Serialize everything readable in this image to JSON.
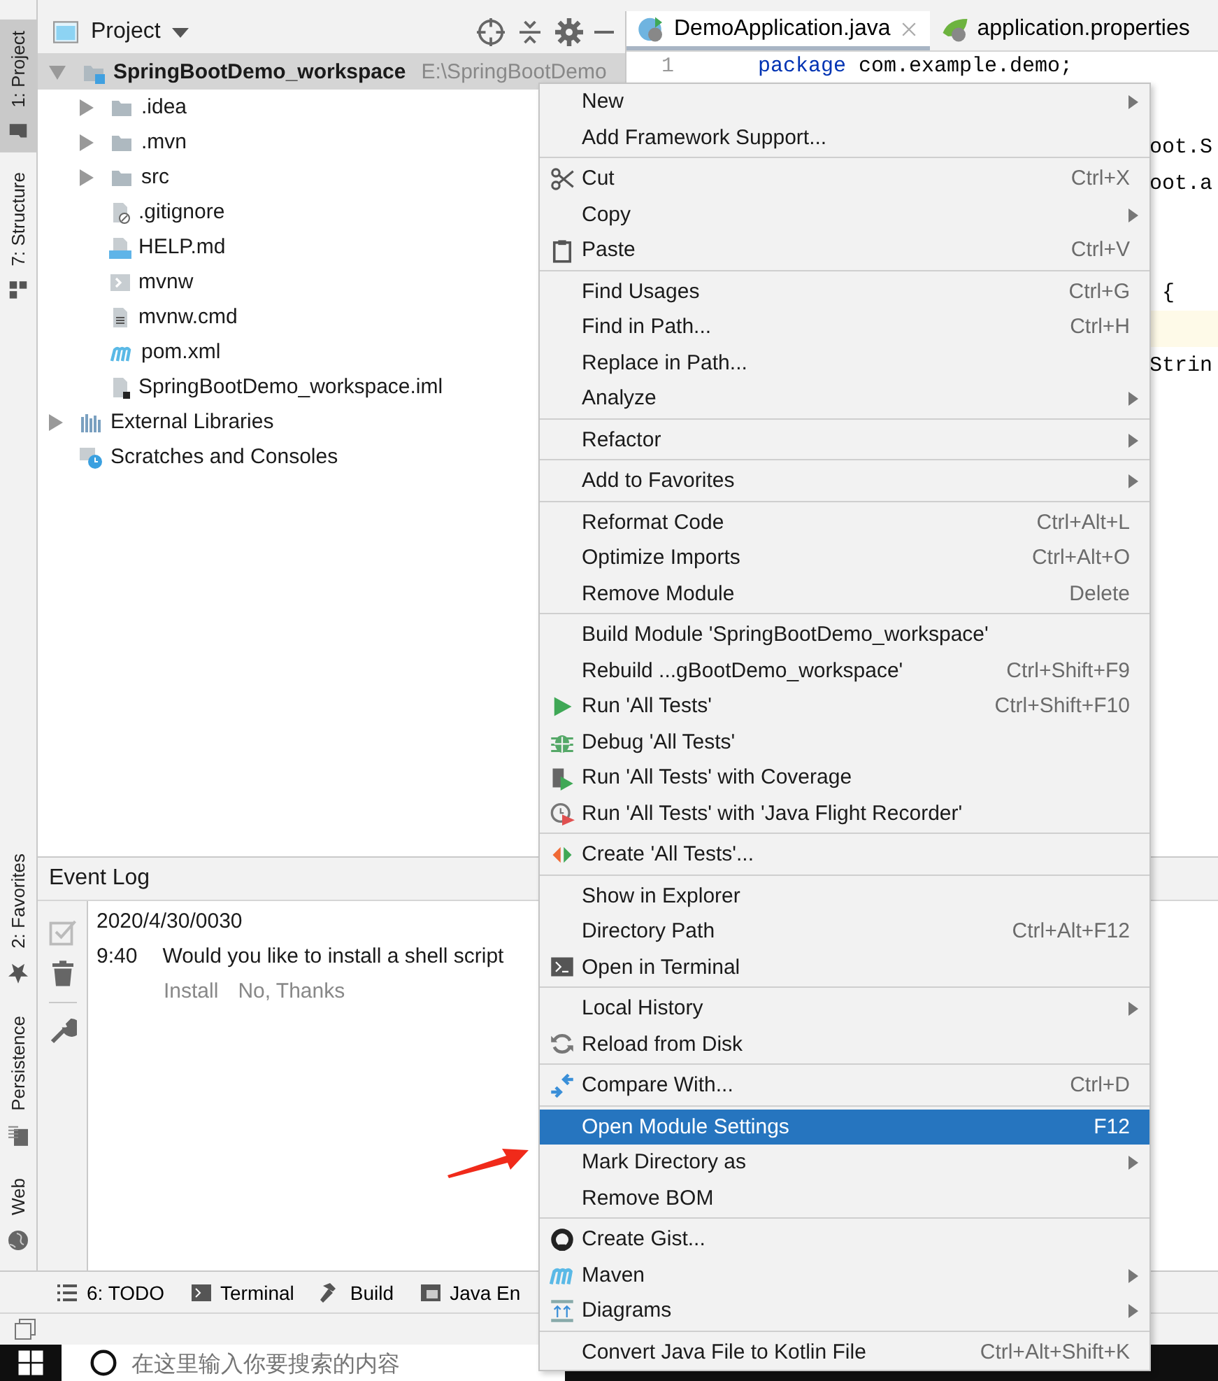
{
  "side_tabs_top": [
    {
      "label": "1: Project",
      "selected": true
    },
    {
      "label": "7: Structure",
      "selected": false
    }
  ],
  "side_tabs_bottom": [
    {
      "label": "2: Favorites",
      "selected": false
    },
    {
      "label": "Persistence",
      "selected": false
    },
    {
      "label": "Web",
      "selected": false
    }
  ],
  "project_panel": {
    "title": "Project",
    "tree": [
      {
        "name": "SpringBootDemo_workspace",
        "path": "E:\\SpringBootDemo",
        "kind": "module",
        "expanded": true,
        "selected": true,
        "children": [
          {
            "name": ".idea",
            "kind": "folder",
            "expanded": false,
            "selected": false
          },
          {
            "name": ".mvn",
            "kind": "folder",
            "expanded": false,
            "selected": false
          },
          {
            "name": "src",
            "kind": "folder",
            "expanded": false,
            "selected": false
          },
          {
            "name": ".gitignore",
            "kind": "file",
            "selected": false
          },
          {
            "name": "HELP.md",
            "kind": "file",
            "selected": false
          },
          {
            "name": "mvnw",
            "kind": "file",
            "selected": false
          },
          {
            "name": "mvnw.cmd",
            "kind": "file",
            "selected": false
          },
          {
            "name": "pom.xml",
            "kind": "file",
            "selected": false
          },
          {
            "name": "SpringBootDemo_workspace.iml",
            "kind": "file",
            "selected": false
          }
        ]
      },
      {
        "name": "External Libraries",
        "kind": "folder",
        "expanded": false,
        "selected": false
      },
      {
        "name": "Scratches and Consoles",
        "kind": "file",
        "selected": false
      }
    ]
  },
  "editor": {
    "tabs": [
      {
        "label": "DemoApplication.java",
        "selected": true
      },
      {
        "label": "application.properties",
        "selected": false
      }
    ],
    "lines": [
      {
        "number": "1",
        "current": false,
        "tokens": [
          {
            "text": "package",
            "kind": "keyword"
          },
          {
            "text": " com.example.demo;",
            "kind": "plain"
          }
        ]
      },
      {
        "current": false
      },
      {
        "current": false,
        "tokens": [
          {
            "text": "oot.S",
            "kind": "plain"
          }
        ]
      },
      {
        "current": false,
        "tokens": [
          {
            "text": "oot.a",
            "kind": "plain"
          }
        ]
      },
      {
        "current": false
      },
      {
        "current": false
      },
      {
        "current": false,
        "tokens": [
          {
            "text": " {",
            "kind": "plain"
          }
        ]
      },
      {
        "current": true
      },
      {
        "current": false,
        "tokens": [
          {
            "text": "Strin",
            "kind": "plain"
          }
        ]
      }
    ]
  },
  "event_log": {
    "title": "Event Log",
    "date": "2020/4/30/0030",
    "entries": [
      {
        "time": "9:40",
        "message": "Would you like to install a shell script",
        "actions": [
          "Install",
          "No, Thanks"
        ]
      }
    ]
  },
  "tool_tabs": [
    "6: TODO",
    "Terminal",
    "Build",
    "Java En"
  ],
  "taskbar": {
    "search_placeholder": "在这里输入你要搜索的内容"
  },
  "context_menu": {
    "groups": [
      [
        {
          "label": "New",
          "submenu": true,
          "selected": false
        },
        {
          "label": "Add Framework Support...",
          "submenu": false,
          "selected": false
        }
      ],
      [
        {
          "label": "Cut",
          "shortcut": "Ctrl+X",
          "submenu": false,
          "selected": false
        },
        {
          "label": "Copy",
          "submenu": true,
          "selected": false
        },
        {
          "label": "Paste",
          "shortcut": "Ctrl+V",
          "submenu": false,
          "selected": false
        }
      ],
      [
        {
          "label": "Find Usages",
          "shortcut": "Ctrl+G",
          "submenu": false,
          "selected": false
        },
        {
          "label": "Find in Path...",
          "shortcut": "Ctrl+H",
          "submenu": false,
          "selected": false
        },
        {
          "label": "Replace in Path...",
          "submenu": false,
          "selected": false
        },
        {
          "label": "Analyze",
          "submenu": true,
          "selected": false
        }
      ],
      [
        {
          "label": "Refactor",
          "submenu": true,
          "selected": false
        }
      ],
      [
        {
          "label": "Add to Favorites",
          "submenu": true,
          "selected": false
        }
      ],
      [
        {
          "label": "Reformat Code",
          "shortcut": "Ctrl+Alt+L",
          "submenu": false,
          "selected": false
        },
        {
          "label": "Optimize Imports",
          "shortcut": "Ctrl+Alt+O",
          "submenu": false,
          "selected": false
        },
        {
          "label": "Remove Module",
          "shortcut": "Delete",
          "submenu": false,
          "selected": false
        }
      ],
      [
        {
          "label": "Build Module 'SpringBootDemo_workspace'",
          "submenu": false,
          "selected": false
        },
        {
          "label": "Rebuild ...gBootDemo_workspace'",
          "shortcut": "Ctrl+Shift+F9",
          "submenu": false,
          "selected": false
        },
        {
          "label": "Run 'All Tests'",
          "shortcut": "Ctrl+Shift+F10",
          "submenu": false,
          "selected": false
        },
        {
          "label": "Debug 'All Tests'",
          "submenu": false,
          "selected": false
        },
        {
          "label": "Run 'All Tests' with Coverage",
          "submenu": false,
          "selected": false
        },
        {
          "label": "Run 'All Tests' with 'Java Flight Recorder'",
          "submenu": false,
          "selected": false
        }
      ],
      [
        {
          "label": "Create 'All Tests'...",
          "submenu": false,
          "selected": false
        }
      ],
      [
        {
          "label": "Show in Explorer",
          "submenu": false,
          "selected": false
        },
        {
          "label": "Directory Path",
          "shortcut": "Ctrl+Alt+F12",
          "submenu": false,
          "selected": false
        },
        {
          "label": "Open in Terminal",
          "submenu": false,
          "selected": false
        }
      ],
      [
        {
          "label": "Local History",
          "submenu": true,
          "selected": false
        },
        {
          "label": "Reload from Disk",
          "submenu": false,
          "selected": false
        }
      ],
      [
        {
          "label": "Compare With...",
          "shortcut": "Ctrl+D",
          "submenu": false,
          "selected": false
        }
      ],
      [
        {
          "label": "Open Module Settings",
          "shortcut": "F12",
          "submenu": false,
          "selected": true
        },
        {
          "label": "Mark Directory as",
          "submenu": true,
          "selected": false
        },
        {
          "label": "Remove BOM",
          "submenu": false,
          "selected": false
        }
      ],
      [
        {
          "label": "Create Gist...",
          "submenu": false,
          "selected": false
        },
        {
          "label": "Maven",
          "submenu": true,
          "selected": false
        },
        {
          "label": "Diagrams",
          "submenu": true,
          "selected": false
        }
      ],
      [
        {
          "label": "Convert Java File to Kotlin File",
          "shortcut": "Ctrl+Alt+Shift+K",
          "submenu": false,
          "selected": false
        }
      ]
    ]
  }
}
